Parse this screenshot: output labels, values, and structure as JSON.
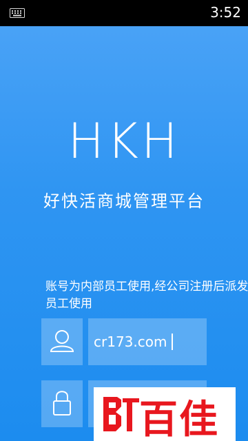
{
  "status_bar": {
    "time": "3:52",
    "keyboard_icon": "keyboard-icon"
  },
  "app": {
    "logo": "HKH",
    "subtitle": "好快活商城管理平台",
    "notice": "账号为内部员工使用,经公司注册后派发员工使用"
  },
  "login": {
    "account": {
      "value": "cr173.com",
      "icon": "user-icon"
    },
    "password": {
      "value": "",
      "icon": "lock-icon"
    }
  },
  "watermark": {
    "text": "百佳"
  }
}
